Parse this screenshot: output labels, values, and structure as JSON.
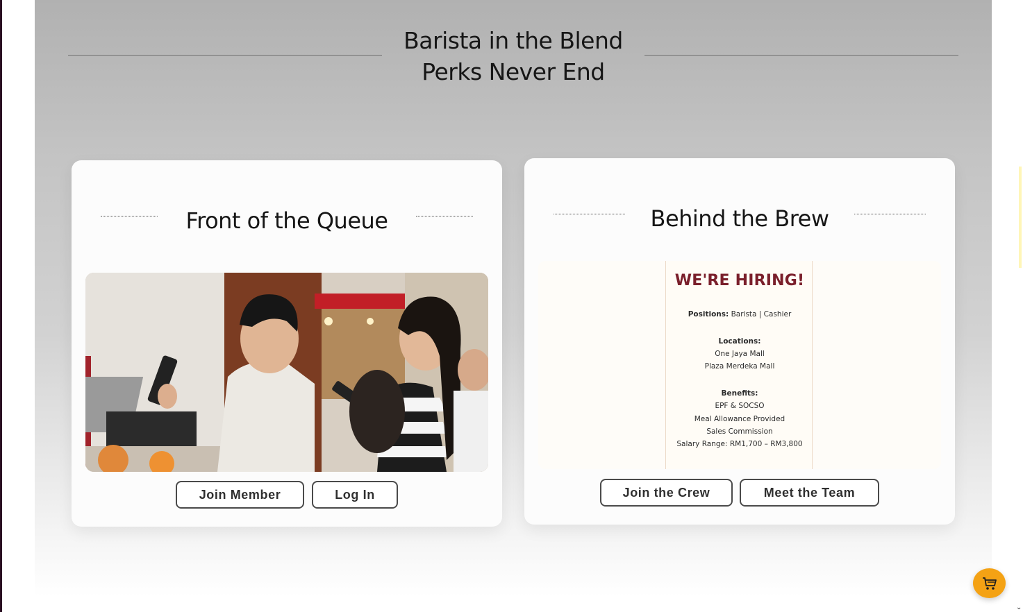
{
  "hero": {
    "title_line1": "Barista in the Blend",
    "title_line2": "Perks Never End"
  },
  "cards": [
    {
      "heading": "Front of the Queue",
      "image_alt": "Customers paying at a cafe counter with their phones",
      "buttons": [
        "Join Member",
        "Log In"
      ]
    },
    {
      "heading": "Behind the Brew",
      "poster": {
        "title": "WE'RE HIRING!",
        "positions_label": "Positions:",
        "positions_value": "Barista | Cashier",
        "locations_label": "Locations:",
        "locations": [
          "One Jaya Mall",
          "Plaza Merdeka Mall"
        ],
        "benefits_label": "Benefits:",
        "benefits": [
          "EPF & SOCSO",
          "Meal Allowance Provided",
          "Sales Commission",
          "Salary Range: RM1,700 – RM3,800"
        ]
      },
      "buttons": [
        "Join the Crew",
        "Meet the Team"
      ]
    }
  ],
  "floating": {
    "cart_icon": "shopping-cart-icon",
    "cart_color": "#f4a214"
  },
  "colors": {
    "poster_title": "#7a1f2b",
    "button_border": "#4a4a4a"
  }
}
